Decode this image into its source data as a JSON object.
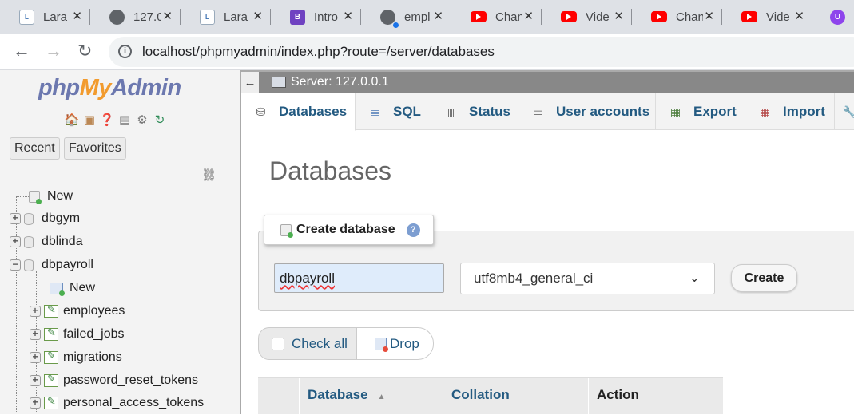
{
  "browser": {
    "tabs": [
      {
        "title": "Lara",
        "icon": "laravel-icon"
      },
      {
        "title": "127.0",
        "icon": "globe-icon"
      },
      {
        "title": "Lara",
        "icon": "laravel-icon"
      },
      {
        "title": "Intro",
        "icon": "bootstrap-icon"
      },
      {
        "title": "empl",
        "icon": "globe-icon"
      },
      {
        "title": "Chan",
        "icon": "youtube-icon"
      },
      {
        "title": "Vide",
        "icon": "youtube-icon"
      },
      {
        "title": "Chan",
        "icon": "youtube-icon"
      },
      {
        "title": "Vide",
        "icon": "youtube-icon"
      }
    ],
    "url": "localhost/phpmyadmin/index.php?route=/server/databases"
  },
  "sidebar": {
    "logo": {
      "php": "php",
      "my": "My",
      "admin": "Admin"
    },
    "nav_tabs": [
      "Recent",
      "Favorites"
    ],
    "tree": {
      "new_label": "New",
      "databases": [
        "dbgym",
        "dblinda",
        "dbpayroll"
      ],
      "expanded_db_new": "New",
      "tables": [
        "employees",
        "failed_jobs",
        "migrations",
        "password_reset_tokens",
        "personal_access_tokens"
      ]
    }
  },
  "server_bar": {
    "text": "Server: 127.0.0.1"
  },
  "top_menu": [
    "Databases",
    "SQL",
    "Status",
    "User accounts",
    "Export",
    "Import"
  ],
  "page": {
    "title": "Databases",
    "create_legend": "Create database",
    "db_name_value": "dbpayroll",
    "collation_value": "utf8mb4_general_ci",
    "create_button": "Create",
    "check_all": "Check all",
    "drop_button": "Drop",
    "table_headers": [
      "Database",
      "Collation",
      "Action"
    ]
  },
  "colors": {
    "accent_link": "#235a81",
    "youtube": "#ff0000",
    "server_bar": "#888888"
  }
}
